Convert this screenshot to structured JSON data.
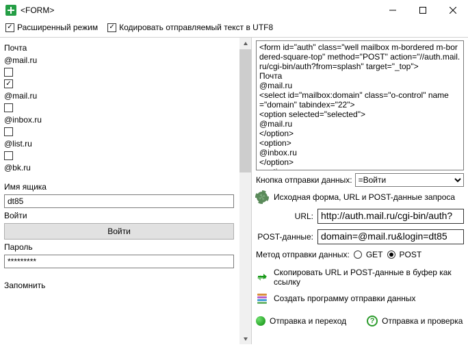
{
  "window": {
    "title": "<FORM>"
  },
  "top": {
    "extmode": "Расширенный режим",
    "encode": "Кодировать отправляемый текст в UTF8"
  },
  "left": {
    "mail_header": "Почта",
    "d1": "@mail.ru",
    "d2": "@mail.ru",
    "d3": "@inbox.ru",
    "d4": "@list.ru",
    "d5": "@bk.ru",
    "acct_label": "Имя ящика",
    "acct_value": "dt85",
    "login_label": "Войти",
    "login_btn": "Войти",
    "pass_label": "Пароль",
    "pass_value": "*********",
    "remember": "Запомнить"
  },
  "code": "<form id=\"auth\" class=\"well mailbox m-bordered m-bordered-square-top\" method=\"POST\" action=\"//auth.mail.ru/cgi-bin/auth?from=splash\" target=\"_top\">\nПочта\n@mail.ru\n<select id=\"mailbox:domain\" class=\"o-control\" name=\"domain\" tabindex=\"22\">\n<option selected=\"selected\">\n@mail.ru\n</option>\n<option>\n@inbox.ru\n</option>\n<option>",
  "submitbtn": {
    "label": "Кнопка отправки данных:",
    "value": "=Войти"
  },
  "src_caption": "Исходная форма, URL и POST-данные запроса",
  "url": {
    "label": "URL:",
    "value": "http://auth.mail.ru/cgi-bin/auth?"
  },
  "post": {
    "label": "POST-данные:",
    "value": "domain=@mail.ru&login=dt85"
  },
  "method": {
    "label": "Метод отправки данных:",
    "get": "GET",
    "post": "POST"
  },
  "copy": "Скопировать URL и POST-данные в буфер как ссылку",
  "make": "Создать программу отправки данных",
  "send_go": "Отправка и переход",
  "send_check": "Отправка и проверка"
}
